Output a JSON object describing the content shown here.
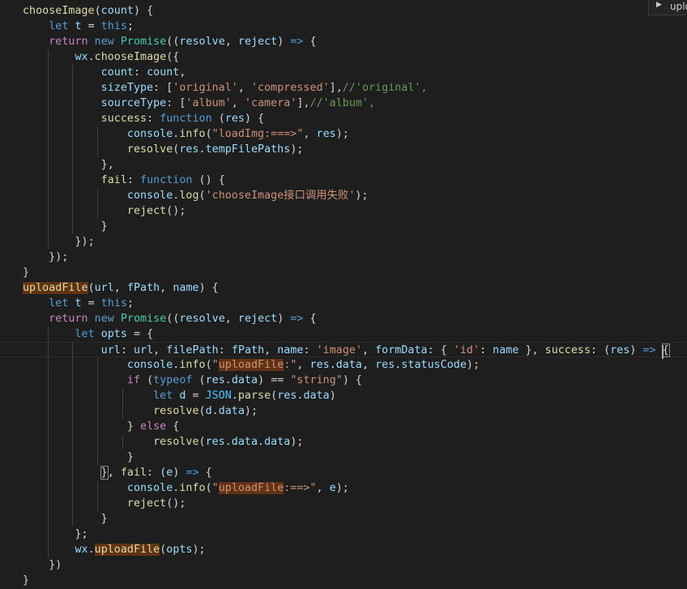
{
  "find_widget": {
    "toggle_icon": "chevron-right-icon",
    "text": "uplo"
  },
  "editor": {
    "current_line": 22,
    "lines": [
      [
        [
          "chooseImage",
          "fn"
        ],
        [
          "(",
          "p"
        ],
        [
          "count",
          "var"
        ],
        [
          ") {",
          "p"
        ]
      ],
      [
        [
          "    ",
          "p"
        ],
        [
          "let",
          "kw"
        ],
        [
          " ",
          "p"
        ],
        [
          "t",
          "var"
        ],
        [
          " = ",
          "p"
        ],
        [
          "this",
          "kw"
        ],
        [
          ";",
          "p"
        ]
      ],
      [
        [
          "    ",
          "p"
        ],
        [
          "return",
          "ctl"
        ],
        [
          " ",
          "p"
        ],
        [
          "new",
          "kw"
        ],
        [
          " ",
          "p"
        ],
        [
          "Promise",
          "cls"
        ],
        [
          "((",
          "p"
        ],
        [
          "resolve",
          "var"
        ],
        [
          ", ",
          "p"
        ],
        [
          "reject",
          "var"
        ],
        [
          ") ",
          "p"
        ],
        [
          "=>",
          "kw"
        ],
        [
          " {",
          "p"
        ]
      ],
      [
        [
          "        ",
          "p"
        ],
        [
          "wx",
          "var"
        ],
        [
          ".",
          "p"
        ],
        [
          "chooseImage",
          "fn"
        ],
        [
          "({",
          "p"
        ]
      ],
      [
        [
          "            ",
          "p"
        ],
        [
          "count",
          "var"
        ],
        [
          ": ",
          "p"
        ],
        [
          "count",
          "var"
        ],
        [
          ",",
          "p"
        ]
      ],
      [
        [
          "            ",
          "p"
        ],
        [
          "sizeType",
          "var"
        ],
        [
          ": [",
          "p"
        ],
        [
          "'original'",
          "str"
        ],
        [
          ", ",
          "p"
        ],
        [
          "'compressed'",
          "str"
        ],
        [
          "],",
          "p"
        ],
        [
          "//'original',",
          "cmt"
        ]
      ],
      [
        [
          "            ",
          "p"
        ],
        [
          "sourceType",
          "var"
        ],
        [
          ": [",
          "p"
        ],
        [
          "'album'",
          "str"
        ],
        [
          ", ",
          "p"
        ],
        [
          "'camera'",
          "str"
        ],
        [
          "],",
          "p"
        ],
        [
          "//'album',",
          "cmt"
        ]
      ],
      [
        [
          "            ",
          "p"
        ],
        [
          "success",
          "fn"
        ],
        [
          ": ",
          "p"
        ],
        [
          "function",
          "kw"
        ],
        [
          " (",
          "p"
        ],
        [
          "res",
          "var"
        ],
        [
          ") {",
          "p"
        ]
      ],
      [
        [
          "                ",
          "p"
        ],
        [
          "console",
          "var"
        ],
        [
          ".",
          "p"
        ],
        [
          "info",
          "fn"
        ],
        [
          "(",
          "p"
        ],
        [
          "\"loadImg:===>\"",
          "str"
        ],
        [
          ", ",
          "p"
        ],
        [
          "res",
          "var"
        ],
        [
          ");",
          "p"
        ]
      ],
      [
        [
          "                ",
          "p"
        ],
        [
          "resolve",
          "fn"
        ],
        [
          "(",
          "p"
        ],
        [
          "res",
          "var"
        ],
        [
          ".",
          "p"
        ],
        [
          "tempFilePaths",
          "var"
        ],
        [
          ");",
          "p"
        ]
      ],
      [
        [
          "            ",
          "p"
        ],
        [
          "},",
          "p"
        ]
      ],
      [
        [
          "            ",
          "p"
        ],
        [
          "fail",
          "fn"
        ],
        [
          ": ",
          "p"
        ],
        [
          "function",
          "kw"
        ],
        [
          " () {",
          "p"
        ]
      ],
      [
        [
          "                ",
          "p"
        ],
        [
          "console",
          "var"
        ],
        [
          ".",
          "p"
        ],
        [
          "log",
          "fn"
        ],
        [
          "(",
          "p"
        ],
        [
          "'chooseImage接口调用失败'",
          "str"
        ],
        [
          ");",
          "p"
        ]
      ],
      [
        [
          "                ",
          "p"
        ],
        [
          "reject",
          "fn"
        ],
        [
          "();",
          "p"
        ]
      ],
      [
        [
          "            ",
          "p"
        ],
        [
          "}",
          "p"
        ]
      ],
      [
        [
          "        ",
          "p"
        ],
        [
          "});",
          "p"
        ]
      ],
      [
        [
          "    ",
          "p"
        ],
        [
          "});",
          "p"
        ]
      ],
      [
        [
          "}",
          "p"
        ]
      ],
      [
        [
          "uploadFile",
          "fn",
          "hl"
        ],
        [
          "(",
          "p"
        ],
        [
          "url",
          "var"
        ],
        [
          ", ",
          "p"
        ],
        [
          "fPath",
          "var"
        ],
        [
          ", ",
          "p"
        ],
        [
          "name",
          "var"
        ],
        [
          ") {",
          "p"
        ]
      ],
      [
        [
          "    ",
          "p"
        ],
        [
          "let",
          "kw"
        ],
        [
          " ",
          "p"
        ],
        [
          "t",
          "var"
        ],
        [
          " = ",
          "p"
        ],
        [
          "this",
          "kw"
        ],
        [
          ";",
          "p"
        ]
      ],
      [
        [
          "    ",
          "p"
        ],
        [
          "return",
          "ctl"
        ],
        [
          " ",
          "p"
        ],
        [
          "new",
          "kw"
        ],
        [
          " ",
          "p"
        ],
        [
          "Promise",
          "cls"
        ],
        [
          "((",
          "p"
        ],
        [
          "resolve",
          "var"
        ],
        [
          ", ",
          "p"
        ],
        [
          "reject",
          "var"
        ],
        [
          ") ",
          "p"
        ],
        [
          "=>",
          "kw"
        ],
        [
          " {",
          "p"
        ]
      ],
      [
        [
          "        ",
          "p"
        ],
        [
          "let",
          "kw"
        ],
        [
          " ",
          "p"
        ],
        [
          "opts",
          "var"
        ],
        [
          " = {",
          "p"
        ]
      ],
      [
        [
          "            ",
          "p"
        ],
        [
          "url",
          "var"
        ],
        [
          ": ",
          "p"
        ],
        [
          "url",
          "var"
        ],
        [
          ", ",
          "p"
        ],
        [
          "filePath",
          "var"
        ],
        [
          ": ",
          "p"
        ],
        [
          "fPath",
          "var"
        ],
        [
          ", ",
          "p"
        ],
        [
          "name",
          "var"
        ],
        [
          ": ",
          "p"
        ],
        [
          "'image'",
          "str"
        ],
        [
          ", ",
          "p"
        ],
        [
          "formData",
          "var"
        ],
        [
          ": { ",
          "p"
        ],
        [
          "'id'",
          "str"
        ],
        [
          ": ",
          "p"
        ],
        [
          "name",
          "var"
        ],
        [
          " }, ",
          "p"
        ],
        [
          "success",
          "fn"
        ],
        [
          ": (",
          "p"
        ],
        [
          "res",
          "var"
        ],
        [
          ") ",
          "p"
        ],
        [
          "=>",
          "kw"
        ],
        [
          " ",
          "p"
        ],
        [
          "{",
          "p",
          "bracket"
        ]
      ],
      [
        [
          "                ",
          "p"
        ],
        [
          "console",
          "var"
        ],
        [
          ".",
          "p"
        ],
        [
          "info",
          "fn"
        ],
        [
          "(",
          "p"
        ],
        [
          "\"",
          "str"
        ],
        [
          "uploadFile",
          "str",
          "hl"
        ],
        [
          ":\"",
          "str"
        ],
        [
          ", ",
          "p"
        ],
        [
          "res",
          "var"
        ],
        [
          ".",
          "p"
        ],
        [
          "data",
          "var"
        ],
        [
          ", ",
          "p"
        ],
        [
          "res",
          "var"
        ],
        [
          ".",
          "p"
        ],
        [
          "statusCode",
          "var"
        ],
        [
          ");",
          "p"
        ]
      ],
      [
        [
          "                ",
          "p"
        ],
        [
          "if",
          "ctl"
        ],
        [
          " (",
          "p"
        ],
        [
          "typeof",
          "kw"
        ],
        [
          " (",
          "p"
        ],
        [
          "res",
          "var"
        ],
        [
          ".",
          "p"
        ],
        [
          "data",
          "var"
        ],
        [
          ") == ",
          "p"
        ],
        [
          "\"string\"",
          "str"
        ],
        [
          ") {",
          "p"
        ]
      ],
      [
        [
          "                    ",
          "p"
        ],
        [
          "let",
          "kw"
        ],
        [
          " ",
          "p"
        ],
        [
          "d",
          "var"
        ],
        [
          " = ",
          "p"
        ],
        [
          "JSON",
          "const"
        ],
        [
          ".",
          "p"
        ],
        [
          "parse",
          "fn"
        ],
        [
          "(",
          "p"
        ],
        [
          "res",
          "var"
        ],
        [
          ".",
          "p"
        ],
        [
          "data",
          "var"
        ],
        [
          ")",
          "p"
        ]
      ],
      [
        [
          "                    ",
          "p"
        ],
        [
          "resolve",
          "fn"
        ],
        [
          "(",
          "p"
        ],
        [
          "d",
          "var"
        ],
        [
          ".",
          "p"
        ],
        [
          "data",
          "var"
        ],
        [
          ");",
          "p"
        ]
      ],
      [
        [
          "                ",
          "p"
        ],
        [
          "} ",
          "p"
        ],
        [
          "else",
          "ctl"
        ],
        [
          " {",
          "p"
        ]
      ],
      [
        [
          "                    ",
          "p"
        ],
        [
          "resolve",
          "fn"
        ],
        [
          "(",
          "p"
        ],
        [
          "res",
          "var"
        ],
        [
          ".",
          "p"
        ],
        [
          "data",
          "var"
        ],
        [
          ".",
          "p"
        ],
        [
          "data",
          "var"
        ],
        [
          ");",
          "p"
        ]
      ],
      [
        [
          "                ",
          "p"
        ],
        [
          "}",
          "p"
        ]
      ],
      [
        [
          "            ",
          "p"
        ],
        [
          "}",
          "p",
          "bracket"
        ],
        [
          ", ",
          "p"
        ],
        [
          "fail",
          "fn"
        ],
        [
          ": (",
          "p"
        ],
        [
          "e",
          "var"
        ],
        [
          ") ",
          "p"
        ],
        [
          "=>",
          "kw"
        ],
        [
          " {",
          "p"
        ]
      ],
      [
        [
          "                ",
          "p"
        ],
        [
          "console",
          "var"
        ],
        [
          ".",
          "p"
        ],
        [
          "info",
          "fn"
        ],
        [
          "(",
          "p"
        ],
        [
          "\"",
          "str"
        ],
        [
          "uploadFile",
          "str",
          "hl"
        ],
        [
          ":==>\"",
          "str"
        ],
        [
          ", ",
          "p"
        ],
        [
          "e",
          "var"
        ],
        [
          ");",
          "p"
        ]
      ],
      [
        [
          "                ",
          "p"
        ],
        [
          "reject",
          "fn"
        ],
        [
          "();",
          "p"
        ]
      ],
      [
        [
          "            ",
          "p"
        ],
        [
          "}",
          "p"
        ]
      ],
      [
        [
          "        ",
          "p"
        ],
        [
          "};",
          "p"
        ]
      ],
      [
        [
          "        ",
          "p"
        ],
        [
          "wx",
          "var"
        ],
        [
          ".",
          "p"
        ],
        [
          "uploadFile",
          "fn",
          "hl"
        ],
        [
          "(",
          "p"
        ],
        [
          "opts",
          "var"
        ],
        [
          ");",
          "p"
        ]
      ],
      [
        [
          "    ",
          "p"
        ],
        [
          "})",
          "p"
        ]
      ],
      [
        [
          "}",
          "p"
        ]
      ]
    ]
  }
}
